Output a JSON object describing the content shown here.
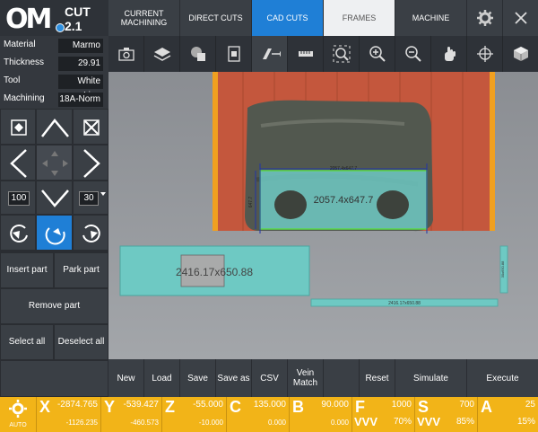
{
  "app": {
    "logo": "OM",
    "version": "CUT 2.1"
  },
  "params": [
    {
      "label": "Material",
      "value": "Marmo"
    },
    {
      "label": "Thickness",
      "value": "29.91"
    },
    {
      "label": "Tool",
      "value": "White Lion"
    },
    {
      "label": "Machining",
      "value": "18A-Norm"
    }
  ],
  "controls": {
    "step_left": "100",
    "step_right": "30"
  },
  "left_buttons": {
    "insert_part": "Insert part",
    "park_part": "Park part",
    "remove_part": "Remove part",
    "select_all": "Select all",
    "deselect_all": "Deselect all"
  },
  "tabs": [
    {
      "label": "CURRENT MACHINING"
    },
    {
      "label": "DIRECT CUTS"
    },
    {
      "label": "CAD CUTS"
    },
    {
      "label": "FRAMES"
    },
    {
      "label": "MACHINE"
    }
  ],
  "toolbar_icons": [
    "camera-icon",
    "layers-icon",
    "shapes-icon",
    "import-icon",
    "transform-icon",
    "ruler-icon",
    "zoom-fit-icon",
    "zoom-in-icon",
    "zoom-out-icon",
    "hand-icon",
    "target-icon",
    "cube-icon"
  ],
  "canvas": {
    "slab_part_label": "2057.4x647.7",
    "slab_part_dim_top": "2057.4x647.7",
    "slab_part_dim_left": "647.7",
    "part2_label": "2416.17x650.88",
    "part3_dim": "2416.17x650.88",
    "part4_dim": "30x650.88"
  },
  "actions": {
    "new": "New",
    "load": "Load",
    "save": "Save",
    "save_as": "Save as",
    "csv": "CSV",
    "vein_match": "Vein Match",
    "reset": "Reset",
    "simulate": "Simulate",
    "execute": "Execute"
  },
  "status": {
    "mode": "AUTO",
    "x": {
      "letter": "X",
      "main": "-2874.765",
      "sub": "-1126.235"
    },
    "y": {
      "letter": "Y",
      "main": "-539.427",
      "sub": "-460.573"
    },
    "z": {
      "letter": "Z",
      "main": "-55.000",
      "sub": "-10.000"
    },
    "c": {
      "letter": "C",
      "main": "135.000",
      "sub": "0.000"
    },
    "b": {
      "letter": "B",
      "main": "90.000",
      "sub": "0.000"
    },
    "f": {
      "letter": "F",
      "main": "1000",
      "vvv": "VVV",
      "sub": "70%"
    },
    "s": {
      "letter": "S",
      "main": "700",
      "vvv": "VVV",
      "sub": "85%"
    },
    "a": {
      "letter": "A",
      "main": "25",
      "sub": "15%"
    }
  },
  "colors": {
    "accent": "#1f7fd6",
    "status_bar": "#f2b418",
    "part": "#6ec9c3",
    "slab_border": "#f0a020"
  }
}
